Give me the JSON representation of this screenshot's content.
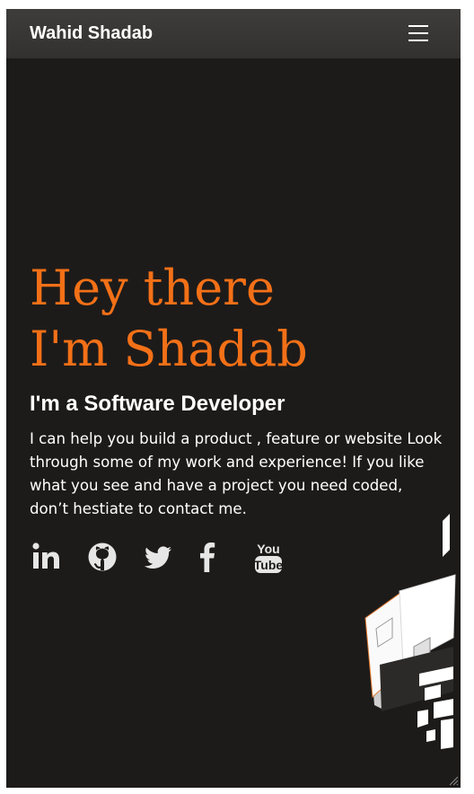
{
  "navbar": {
    "brand": "Wahid Shadab",
    "menu_icon": "hamburger-menu-icon"
  },
  "hero": {
    "title_line1": "Hey there",
    "title_line2": "I'm Shadab",
    "subtitle": "I'm a Software Developer",
    "intro": "I can help you build a product , feature or website Look through some of my work and experience! If you like what you see and have a project you need coded, don’t hestiate to contact me."
  },
  "social": [
    {
      "icon": "linkedin-icon"
    },
    {
      "icon": "github-icon"
    },
    {
      "icon": "twitter-icon"
    },
    {
      "icon": "facebook-icon"
    },
    {
      "icon": "youtube-icon",
      "text_top": "You",
      "text_bottom": "Tube"
    }
  ],
  "colors": {
    "background": "#1d1b1a",
    "navbar": "#3a3837",
    "accent": "#f37017",
    "text": "#ffffff",
    "icons": "#e6e6e6"
  }
}
